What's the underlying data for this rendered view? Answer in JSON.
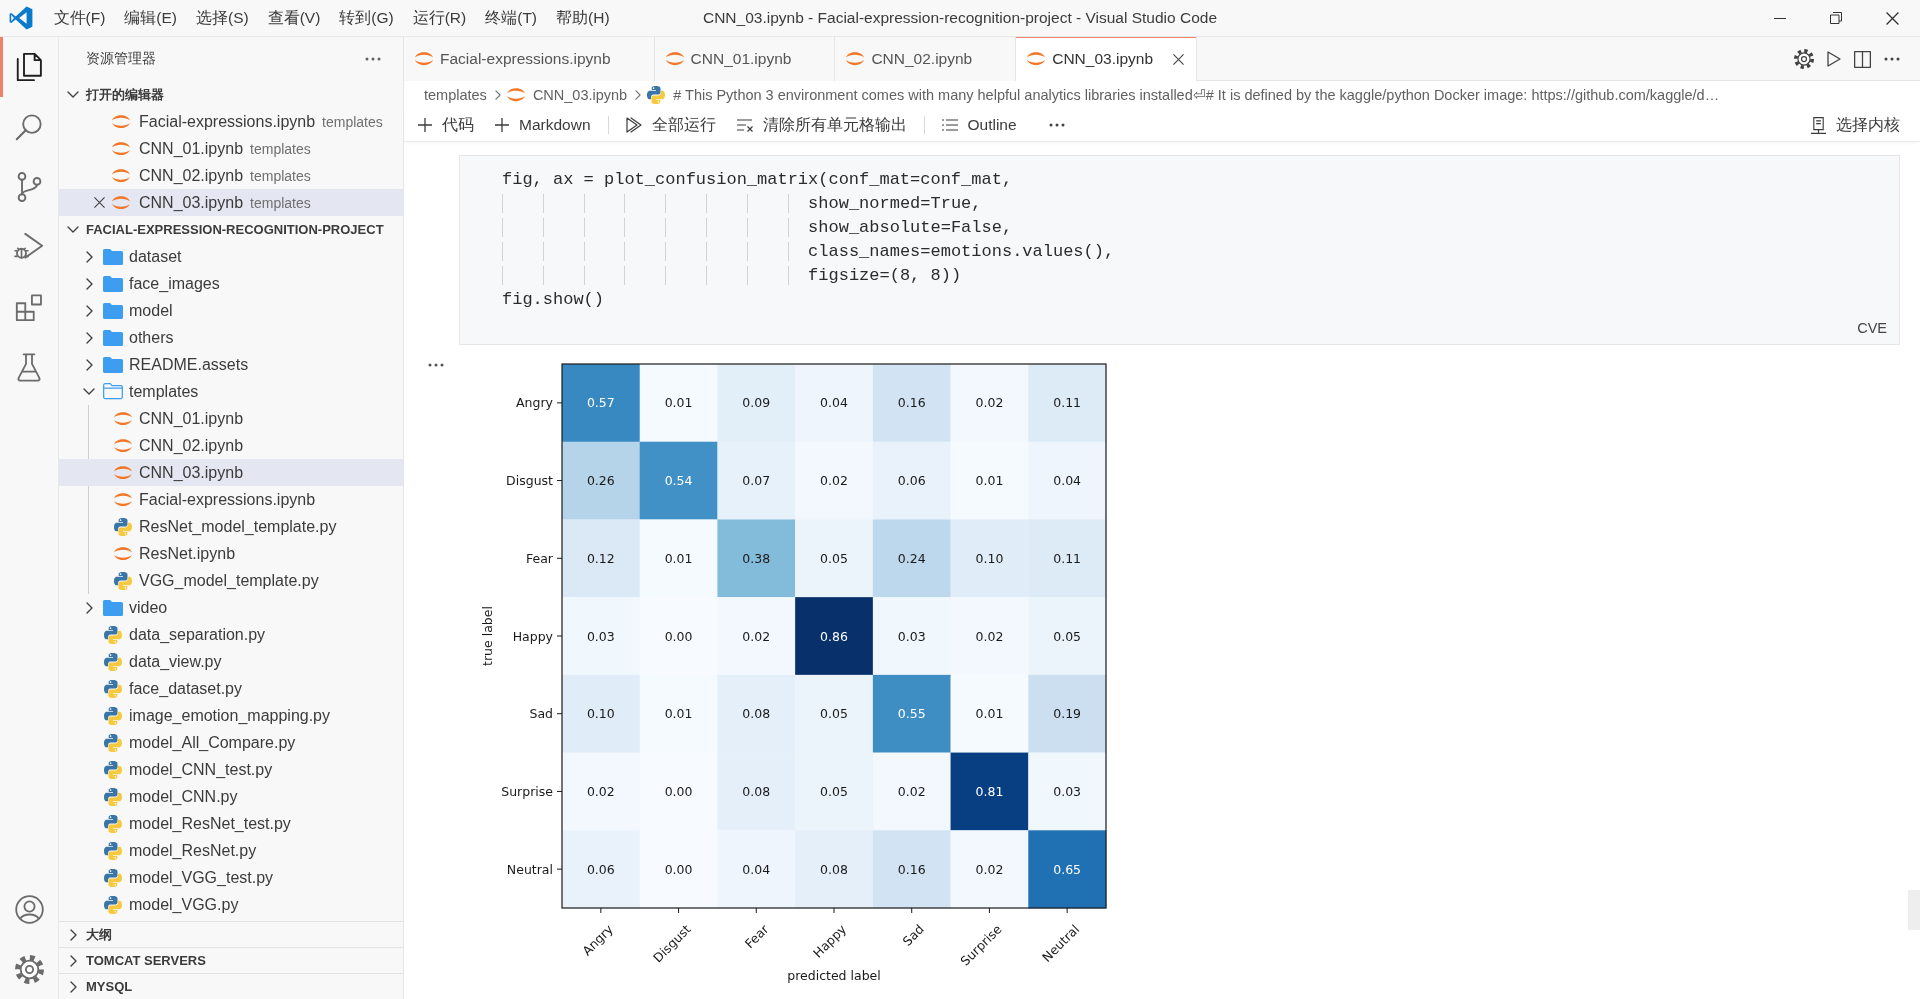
{
  "title_bar": {
    "menus": [
      "文件(F)",
      "编辑(E)",
      "选择(S)",
      "查看(V)",
      "转到(G)",
      "运行(R)",
      "终端(T)",
      "帮助(H)"
    ],
    "title": "CNN_03.ipynb - Facial-expression-recognition-project - Visual Studio Code"
  },
  "activity_bar": {
    "items": [
      {
        "kind": "explorer",
        "selected": true
      },
      {
        "kind": "search",
        "selected": false
      },
      {
        "kind": "source_control",
        "selected": false
      },
      {
        "kind": "run_debug",
        "selected": false
      },
      {
        "kind": "extensions",
        "selected": false
      },
      {
        "kind": "testing",
        "selected": false
      }
    ],
    "bottom_items": [
      {
        "kind": "accounts",
        "selected": false
      },
      {
        "kind": "settings",
        "selected": false
      }
    ]
  },
  "sidebar": {
    "title": "资源管理器",
    "open_editors": {
      "title": "打开的编辑器",
      "expanded": true,
      "items": [
        {
          "name": "Facial-expressions.ipynb",
          "description": "templates",
          "kind": "notebook",
          "selected": false
        },
        {
          "name": "CNN_01.ipynb",
          "description": "templates",
          "kind": "notebook",
          "selected": false
        },
        {
          "name": "CNN_02.ipynb",
          "description": "templates",
          "kind": "notebook",
          "selected": false
        },
        {
          "name": "CNN_03.ipynb",
          "description": "templates",
          "kind": "notebook",
          "selected": true
        }
      ]
    },
    "project": {
      "title": "FACIAL-EXPRESSION-RECOGNITION-PROJECT",
      "expanded": true,
      "children": [
        {
          "name": "dataset",
          "kind": "folder",
          "expanded": false,
          "selected": false
        },
        {
          "name": "face_images",
          "kind": "folder",
          "expanded": false,
          "selected": false
        },
        {
          "name": "model",
          "kind": "folder",
          "expanded": false,
          "selected": false
        },
        {
          "name": "others",
          "kind": "folder",
          "expanded": false,
          "selected": false
        },
        {
          "name": "README.assets",
          "kind": "folder",
          "expanded": false,
          "selected": false
        },
        {
          "name": "templates",
          "kind": "folder",
          "expanded": true,
          "selected": false,
          "children": [
            {
              "name": "CNN_01.ipynb",
              "kind": "notebook",
              "selected": false
            },
            {
              "name": "CNN_02.ipynb",
              "kind": "notebook",
              "selected": false
            },
            {
              "name": "CNN_03.ipynb",
              "kind": "notebook",
              "selected": true
            },
            {
              "name": "Facial-expressions.ipynb",
              "kind": "notebook",
              "selected": false
            },
            {
              "name": "ResNet_model_template.py",
              "kind": "python",
              "selected": false
            },
            {
              "name": "ResNet.ipynb",
              "kind": "notebook",
              "selected": false
            },
            {
              "name": "VGG_model_template.py",
              "kind": "python",
              "selected": false
            }
          ]
        },
        {
          "name": "video",
          "kind": "folder",
          "expanded": false,
          "selected": false
        },
        {
          "name": "data_separation.py",
          "kind": "python",
          "selected": false
        },
        {
          "name": "data_view.py",
          "kind": "python",
          "selected": false
        },
        {
          "name": "face_dataset.py",
          "kind": "python",
          "selected": false
        },
        {
          "name": "image_emotion_mapping.py",
          "kind": "python",
          "selected": false
        },
        {
          "name": "model_All_Compare.py",
          "kind": "python",
          "selected": false
        },
        {
          "name": "model_CNN_test.py",
          "kind": "python",
          "selected": false
        },
        {
          "name": "model_CNN.py",
          "kind": "python",
          "selected": false
        },
        {
          "name": "model_ResNet_test.py",
          "kind": "python",
          "selected": false
        },
        {
          "name": "model_ResNet.py",
          "kind": "python",
          "selected": false
        },
        {
          "name": "model_VGG_test.py",
          "kind": "python",
          "selected": false
        },
        {
          "name": "model_VGG.py",
          "kind": "python",
          "selected": false
        }
      ]
    },
    "panels": [
      {
        "title": "大纲",
        "expanded": false
      },
      {
        "title": "TOMCAT SERVERS",
        "expanded": false
      },
      {
        "title": "MYSQL",
        "expanded": false
      }
    ]
  },
  "editor": {
    "tabs": [
      {
        "label": "Facial-expressions.ipynb",
        "kind": "notebook",
        "selected": false
      },
      {
        "label": "CNN_01.ipynb",
        "kind": "notebook",
        "selected": false
      },
      {
        "label": "CNN_02.ipynb",
        "kind": "notebook",
        "selected": false
      },
      {
        "label": "CNN_03.ipynb",
        "kind": "notebook",
        "selected": true
      }
    ],
    "breadcrumb": [
      {
        "kind": "folder",
        "label": "templates"
      },
      {
        "kind": "notebook",
        "label": "CNN_03.ipynb"
      },
      {
        "kind": "python",
        "label": "# This Python 3 environment comes with many helpful analytics libraries installed⏎# It is defined by the kaggle/python Docker image: https://github.com/kaggle/d…"
      }
    ],
    "toolbar": {
      "groups": [
        [
          {
            "kind": "add",
            "label": "代码"
          },
          {
            "kind": "add",
            "label": "Markdown"
          }
        ],
        [
          {
            "kind": "run_all",
            "label": "全部运行"
          },
          {
            "kind": "clear",
            "label": "清除所有单元格输出"
          }
        ],
        [
          {
            "kind": "outline",
            "label": "Outline"
          }
        ]
      ],
      "kernel": "选择内核"
    },
    "cells": [
      {
        "kind": "code",
        "lines": [
          "fig, ax = plot_confusion_matrix(conf_mat=conf_mat,",
          "                              show_normed=True,",
          "                              show_absolute=False,",
          "                              class_names=emotions.values(),",
          "                              figsize=(8, 8))",
          "fig.show()"
        ],
        "language": "CVE"
      },
      {
        "kind": "output",
        "figure": {
          "ylabel": "true label",
          "xlabel": "predicted label",
          "row_labels": [
            "Angry",
            "Disgust",
            "Fear",
            "Happy",
            "Sad",
            "Surprise",
            "Neutral"
          ],
          "column_labels": [
            "Angry",
            "Disgust",
            "Fear",
            "Happy",
            "Sad",
            "Surprise",
            "Neutral"
          ],
          "values": [
            [
              "0.57",
              "0.01",
              "0.09",
              "0.04",
              "0.16",
              "0.02",
              "0.11"
            ],
            [
              "0.26",
              "0.54",
              "0.07",
              "0.02",
              "0.06",
              "0.01",
              "0.04"
            ],
            [
              "0.12",
              "0.01",
              "0.38",
              "0.05",
              "0.24",
              "0.10",
              "0.11"
            ],
            [
              "0.03",
              "0.00",
              "0.02",
              "0.86",
              "0.03",
              "0.02",
              "0.05"
            ],
            [
              "0.10",
              "0.01",
              "0.08",
              "0.05",
              "0.55",
              "0.01",
              "0.19"
            ],
            [
              "0.02",
              "0.00",
              "0.08",
              "0.05",
              "0.02",
              "0.81",
              "0.03"
            ],
            [
              "0.06",
              "0.00",
              "0.04",
              "0.08",
              "0.16",
              "0.02",
              "0.65"
            ]
          ]
        }
      }
    ]
  }
}
